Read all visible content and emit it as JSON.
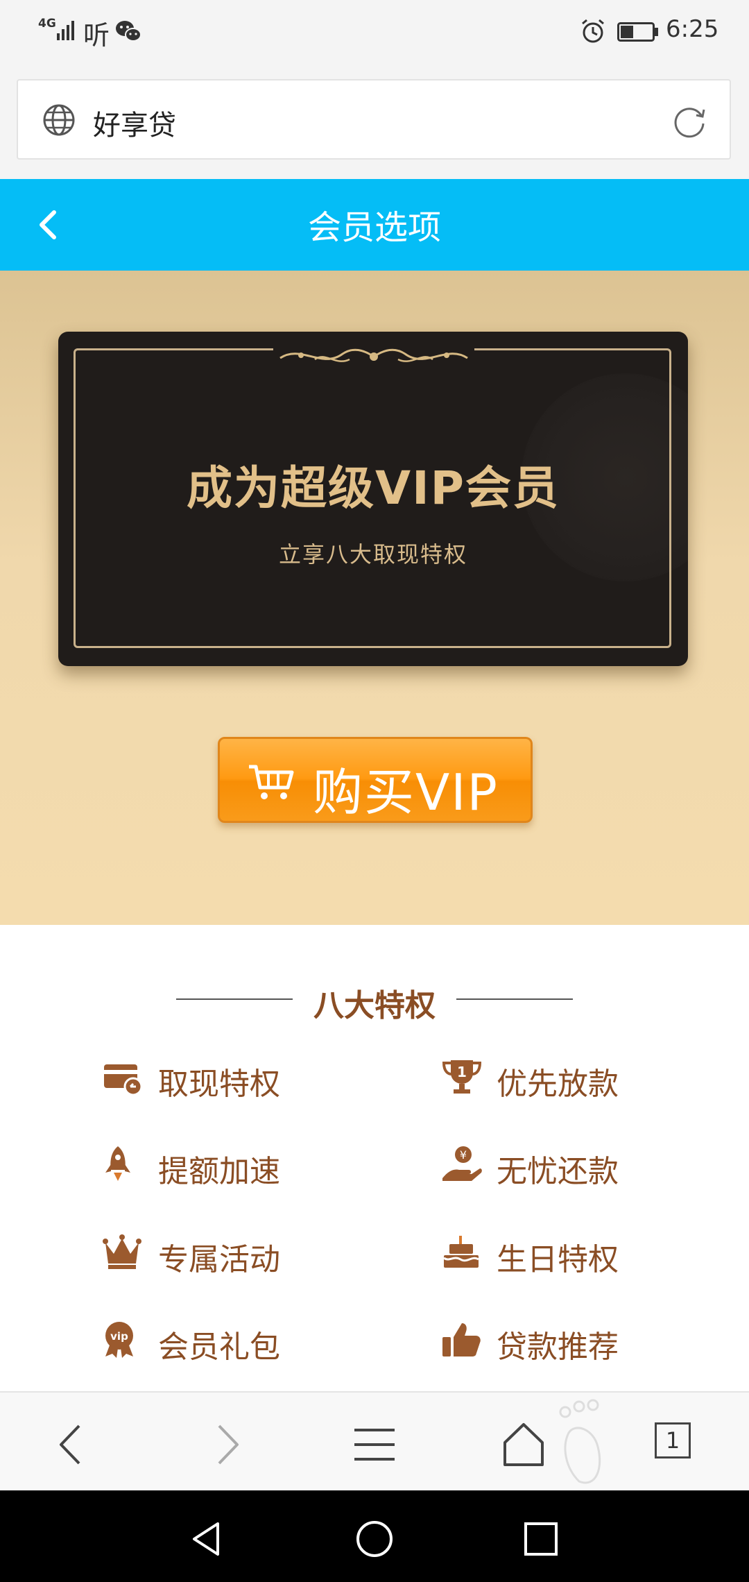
{
  "status_bar": {
    "network": "4G",
    "ting": "听",
    "time": "6:25"
  },
  "address_bar": {
    "text": "好享贷"
  },
  "header": {
    "title": "会员选项"
  },
  "vip_card": {
    "title": "成为超级VIP会员",
    "subtitle": "立享八大取现特权"
  },
  "buy_button": {
    "label": "购买VIP"
  },
  "privileges": {
    "title": "八大特权",
    "items": [
      {
        "label": "取现特权",
        "icon": "card-icon"
      },
      {
        "label": "优先放款",
        "icon": "trophy-icon"
      },
      {
        "label": "提额加速",
        "icon": "rocket-icon"
      },
      {
        "label": "无忧还款",
        "icon": "hand-coin-icon"
      },
      {
        "label": "专属活动",
        "icon": "crown-icon"
      },
      {
        "label": "生日特权",
        "icon": "cake-icon"
      },
      {
        "label": "会员礼包",
        "icon": "vip-badge-icon"
      },
      {
        "label": "贷款推荐",
        "icon": "thumbs-up-icon"
      }
    ]
  },
  "browser_nav": {
    "tab_count": "1"
  },
  "colors": {
    "header_blue": "#05bdf6",
    "privilege_brown": "#8a4d24",
    "buy_orange": "#ff9a12",
    "card_gold": "#e2c089"
  }
}
